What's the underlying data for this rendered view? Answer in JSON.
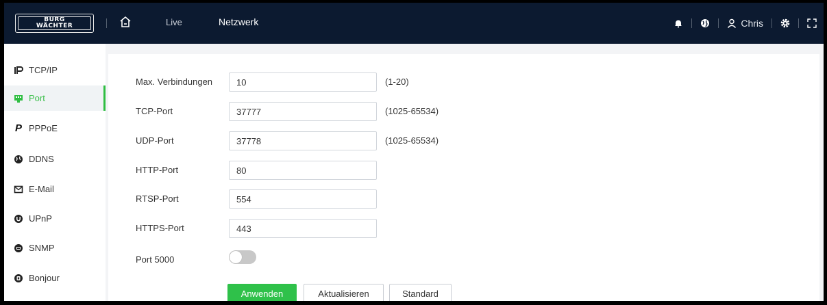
{
  "brand": {
    "logo_line1": "BURG",
    "logo_line2": "WÄCHTER"
  },
  "topbar": {
    "nav_live": "Live",
    "nav_network": "Netzwerk",
    "user_name": "Chris",
    "icons": [
      "home-icon",
      "bell-icon",
      "globe-icon",
      "user-icon",
      "settings-icon",
      "fullscreen-icon"
    ]
  },
  "sidebar": {
    "items": [
      {
        "label": "TCP/IP",
        "icon": "tcpip-icon"
      },
      {
        "label": "Port",
        "icon": "port-icon",
        "active": true
      },
      {
        "label": "PPPoE",
        "icon": "pppoe-icon"
      },
      {
        "label": "DDNS",
        "icon": "ddns-icon"
      },
      {
        "label": "E-Mail",
        "icon": "email-icon"
      },
      {
        "label": "UPnP",
        "icon": "upnp-icon"
      },
      {
        "label": "SNMP",
        "icon": "snmp-icon"
      },
      {
        "label": "Bonjour",
        "icon": "bonjour-icon"
      }
    ]
  },
  "form": {
    "max_connections": {
      "label": "Max. Verbindungen",
      "value": "10",
      "hint": "(1-20)"
    },
    "tcp_port": {
      "label": "TCP-Port",
      "value": "37777",
      "hint": "(1025-65534)"
    },
    "udp_port": {
      "label": "UDP-Port",
      "value": "37778",
      "hint": "(1025-65534)"
    },
    "http_port": {
      "label": "HTTP-Port",
      "value": "80"
    },
    "rtsp_port": {
      "label": "RTSP-Port",
      "value": "554"
    },
    "https_port": {
      "label": "HTTPS-Port",
      "value": "443"
    },
    "port5000": {
      "label": "Port 5000",
      "enabled": false
    }
  },
  "buttons": {
    "apply": "Anwenden",
    "refresh": "Aktualisieren",
    "default": "Standard"
  },
  "colors": {
    "topbar": "#0c1a30",
    "accent": "#2fc14a",
    "active_text": "#3bbf4a"
  }
}
